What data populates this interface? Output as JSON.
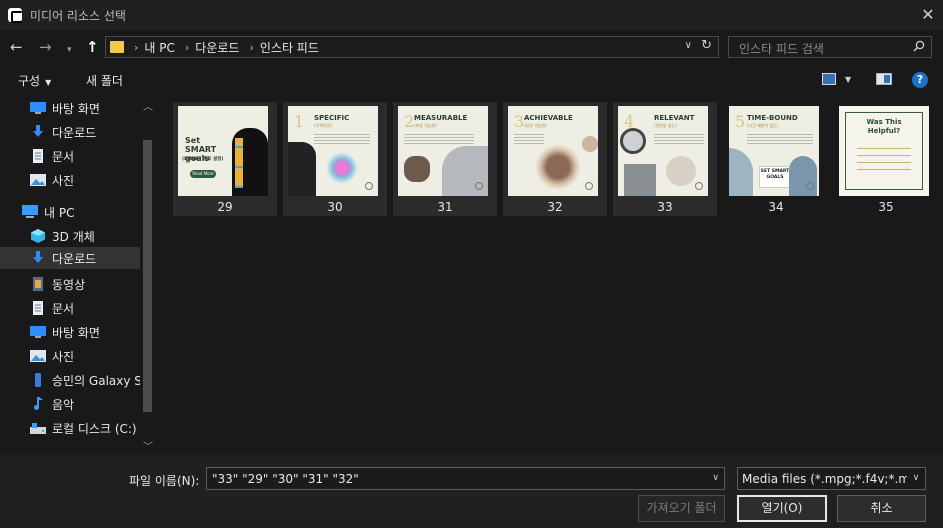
{
  "window": {
    "title": "미디어 리소스 선택"
  },
  "nav": {
    "breadcrumbs": [
      "내 PC",
      "다운로드",
      "인스타 피드"
    ],
    "search_placeholder": "인스타 피드 검색"
  },
  "toolbar": {
    "organize_label": "구성",
    "new_folder_label": "새 폴더"
  },
  "sidebar": {
    "items": [
      {
        "label": "바탕 화면",
        "icon": "desktop-icon",
        "pinned": true
      },
      {
        "label": "다운로드",
        "icon": "download-icon",
        "pinned": true
      },
      {
        "label": "문서",
        "icon": "document-icon",
        "pinned": true
      },
      {
        "label": "사진",
        "icon": "picture-icon",
        "pinned": true
      },
      {
        "label": "내 PC",
        "icon": "computer-icon"
      },
      {
        "label": "3D 개체",
        "icon": "cube-icon"
      },
      {
        "label": "다운로드",
        "icon": "download-icon",
        "selected": true
      },
      {
        "label": "동영상",
        "icon": "video-icon"
      },
      {
        "label": "문서",
        "icon": "document-icon"
      },
      {
        "label": "바탕 화면",
        "icon": "desktop-icon"
      },
      {
        "label": "사진",
        "icon": "picture-icon"
      },
      {
        "label": "승민의 Galaxy S",
        "icon": "phone-icon"
      },
      {
        "label": "음악",
        "icon": "music-icon"
      },
      {
        "label": "로컬 디스크 (C:)",
        "icon": "drive-icon"
      }
    ]
  },
  "files": [
    {
      "name": "29",
      "selected": true,
      "thumb_title": "Set SMART goals",
      "thumb_subtitle": "(SMART 목표 설정)",
      "button": "Read More"
    },
    {
      "name": "30",
      "selected": true,
      "thumb_title": "SPECIFIC",
      "thumb_subtitle": "(구체적인)",
      "number": "1"
    },
    {
      "name": "31",
      "selected": true,
      "thumb_title": "MEASURABLE",
      "thumb_subtitle": "(측정 가능한)",
      "number": "2"
    },
    {
      "name": "32",
      "selected": true,
      "thumb_title": "ACHIEVABLE",
      "thumb_subtitle": "(달성 가능한)",
      "number": "3"
    },
    {
      "name": "33",
      "selected": true,
      "thumb_title": "RELEVANT",
      "thumb_subtitle": "(관련성 있는)",
      "number": "4"
    },
    {
      "name": "34",
      "selected": false,
      "thumb_title": "TIME-BOUND",
      "thumb_subtitle": "(시간 제한이 있는)",
      "number": "5",
      "sign": "SET SMART GOALS"
    },
    {
      "name": "35",
      "selected": false,
      "thumb_title": "Was This Helpful?"
    }
  ],
  "bottom": {
    "filename_label": "파일 이름(N):",
    "filename_value": "\"33\" \"29\" \"30\" \"31\" \"32\"",
    "filetype_value": "Media files (*.mpg;*.f4v;*.mov;",
    "import_folder_label": "가져오기 폴더",
    "open_label": "열기(O)",
    "cancel_label": "취소"
  },
  "colors": {
    "background": "#191919",
    "selected_tile": "#2b2b2b",
    "accent": "#1a73c9"
  }
}
